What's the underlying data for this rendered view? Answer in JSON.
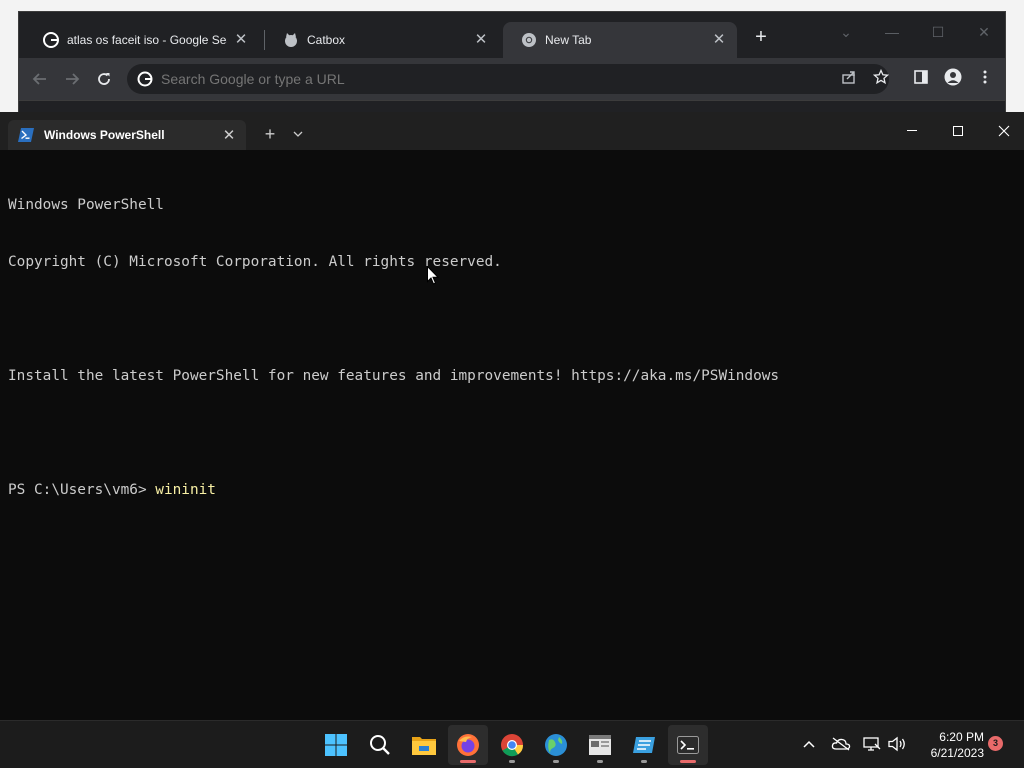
{
  "chrome": {
    "tabs": [
      {
        "title": "atlas os faceit iso - Google Search"
      },
      {
        "title": "Catbox"
      },
      {
        "title": "New Tab"
      }
    ],
    "omnibox_placeholder": "Search Google or type a URL"
  },
  "terminal": {
    "tab_title": "Windows PowerShell",
    "lines": [
      "Windows PowerShell",
      "Copyright (C) Microsoft Corporation. All rights reserved.",
      "",
      "Install the latest PowerShell for new features and improvements! https://aka.ms/PSWindows",
      ""
    ],
    "prompt": "PS C:\\Users\\vm6> ",
    "command": "wininit"
  },
  "taskbar": {
    "clock_time": "6:20 PM",
    "clock_date": "6/21/2023",
    "notification_count": "3"
  },
  "colors": {
    "terminal_bg": "#0c0c0c",
    "command_text": "#f9f1a5",
    "notification_badge": "#e86a6a"
  }
}
